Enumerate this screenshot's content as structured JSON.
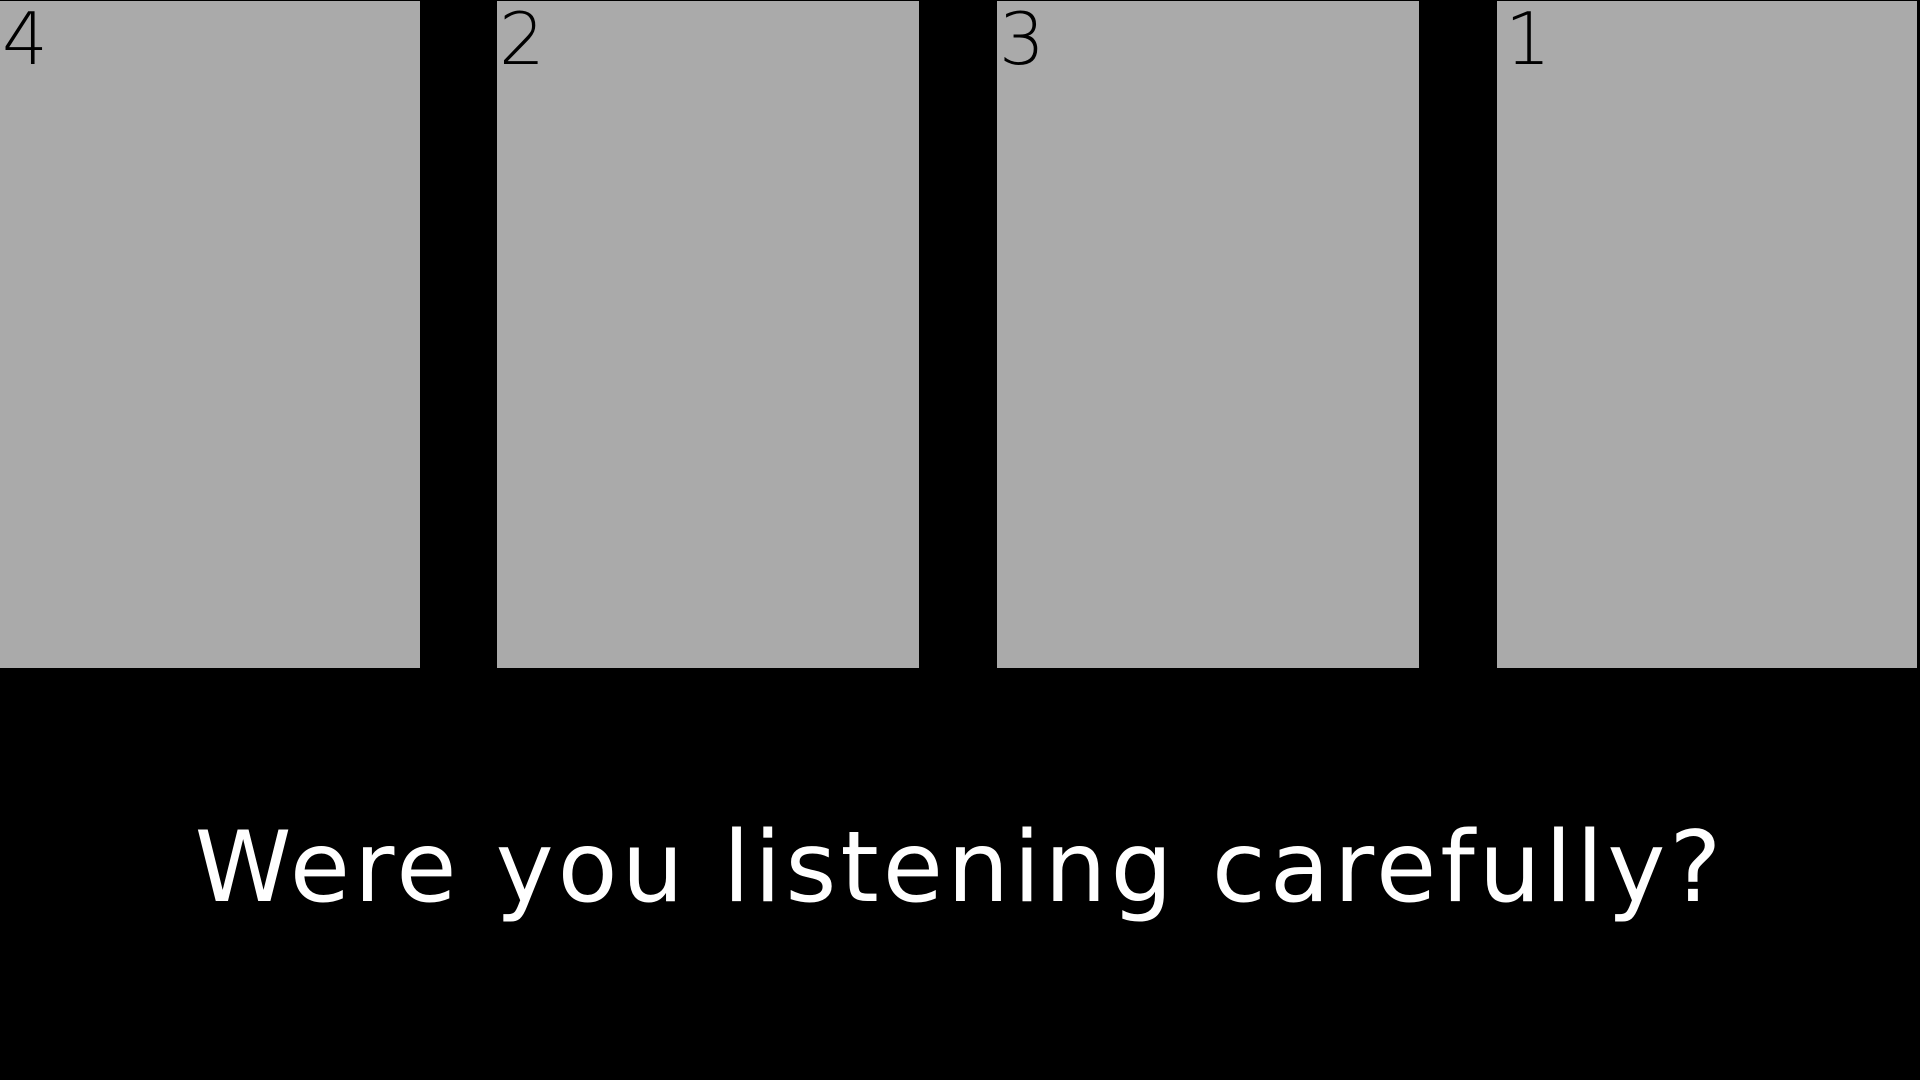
{
  "panels": [
    {
      "label": "4"
    },
    {
      "label": "2"
    },
    {
      "label": "3"
    },
    {
      "label": "1"
    }
  ],
  "question": "Were you listening carefully?",
  "colors": {
    "background": "#000000",
    "panel": "#aaaaaa",
    "panel_text": "#000000",
    "question_text": "#ffffff"
  }
}
